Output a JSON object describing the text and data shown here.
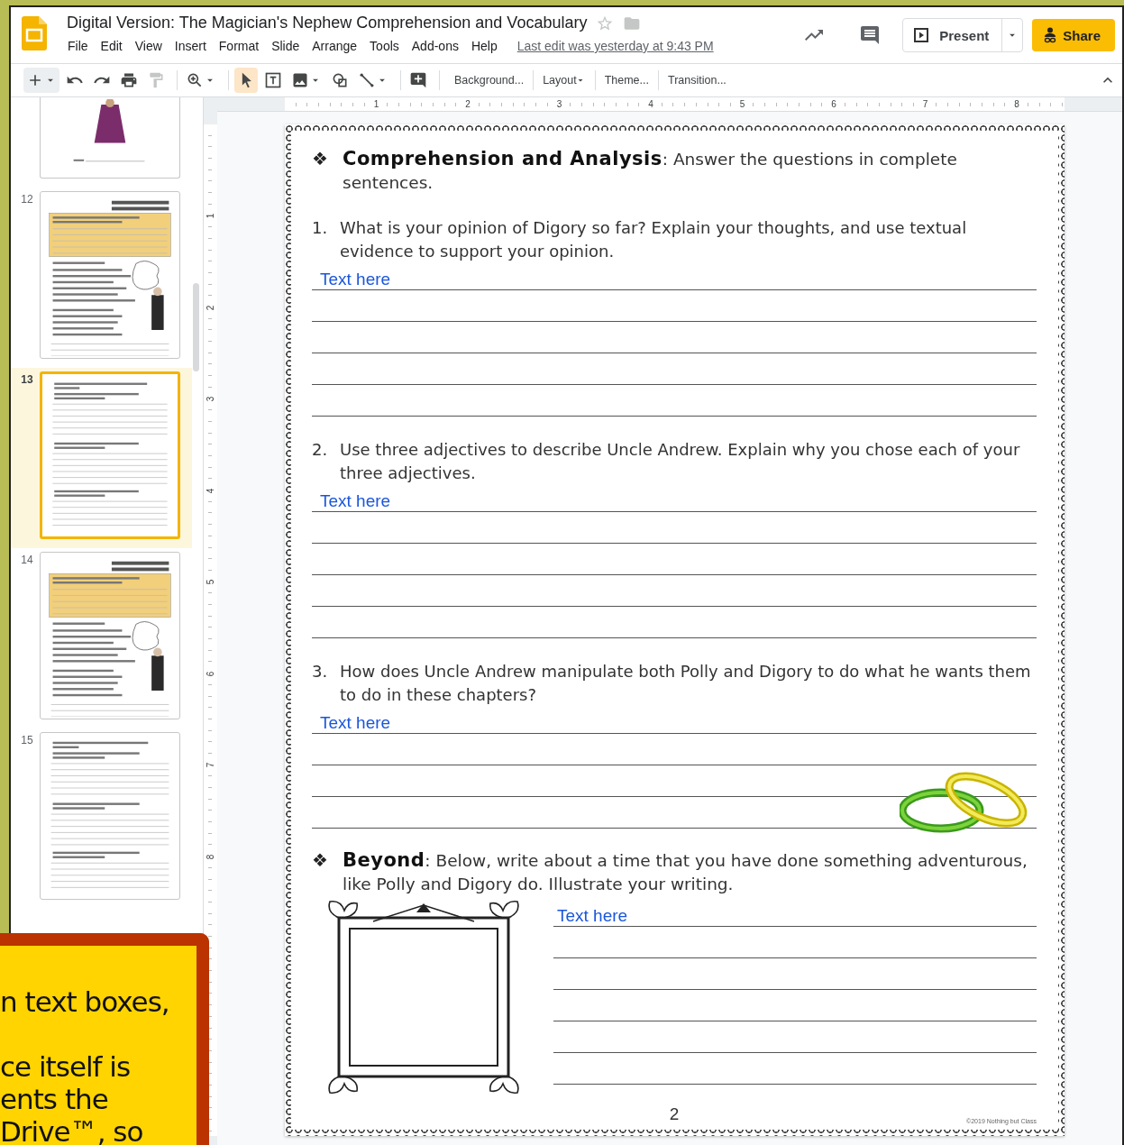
{
  "header": {
    "title": "Digital Version: The Magician's Nephew Comprehension and Vocabulary",
    "starred": false,
    "menu": [
      "File",
      "Edit",
      "View",
      "Insert",
      "Format",
      "Slide",
      "Arrange",
      "Tools",
      "Add-ons",
      "Help"
    ],
    "last_edit": "Last edit was yesterday at 9:43 PM",
    "present": "Present",
    "share": "Share"
  },
  "toolbar": {
    "tools": [
      {
        "kind": "new",
        "dropdown": true,
        "selected": false,
        "disabled": false
      },
      {
        "kind": "undo",
        "dropdown": false,
        "selected": false,
        "disabled": false
      },
      {
        "kind": "redo",
        "dropdown": false,
        "selected": false,
        "disabled": false
      },
      {
        "kind": "print",
        "dropdown": false,
        "selected": false,
        "disabled": false
      },
      {
        "kind": "paint",
        "dropdown": false,
        "selected": false,
        "disabled": true
      },
      {
        "kind": "zoom",
        "dropdown": true,
        "selected": false,
        "disabled": false
      },
      {
        "kind": "select",
        "dropdown": false,
        "selected": true,
        "disabled": false
      },
      {
        "kind": "textbox",
        "dropdown": false,
        "selected": false,
        "disabled": false
      },
      {
        "kind": "image",
        "dropdown": true,
        "selected": false,
        "disabled": false
      },
      {
        "kind": "shape",
        "dropdown": false,
        "selected": false,
        "disabled": false
      },
      {
        "kind": "line",
        "dropdown": true,
        "selected": false,
        "disabled": false
      },
      {
        "kind": "comment",
        "dropdown": false,
        "selected": false,
        "disabled": false
      }
    ],
    "text_buttons": [
      {
        "label": "Background...",
        "dropdown": false
      },
      {
        "label": "Layout",
        "dropdown": true
      },
      {
        "label": "Theme...",
        "dropdown": false
      },
      {
        "label": "Transition...",
        "dropdown": false
      }
    ]
  },
  "rulers": {
    "horizontal": [
      "1",
      "2",
      "3",
      "4",
      "5",
      "6",
      "7",
      "8"
    ],
    "vertical": [
      "1",
      "2",
      "3",
      "4",
      "5",
      "6",
      "7",
      "8"
    ]
  },
  "filmstrip": {
    "slides": [
      {
        "kind": "cover",
        "selected": false
      },
      {
        "number": "12",
        "kind": "chapter",
        "selected": false
      },
      {
        "number": "13",
        "kind": "questions",
        "selected": true
      },
      {
        "number": "14",
        "kind": "chapter",
        "selected": false
      },
      {
        "number": "15",
        "kind": "questions",
        "selected": false
      }
    ]
  },
  "slide": {
    "sections": [
      {
        "kind": "questions",
        "bullet": "❖",
        "heading": "**Comprehension and Analysis**: Answer the questions in complete sentences.",
        "questions": [
          {
            "number": "1.",
            "text": "What is your opinion of Digory so far? Explain your thoughts, and use textual evidence to support your opinion.",
            "answer": "Text here"
          },
          {
            "number": "2.",
            "text": "Use three adjectives to describe Uncle Andrew. Explain why you chose each of your three adjectives.",
            "answer": "Text here"
          },
          {
            "number": "3.",
            "text": "How does Uncle Andrew manipulate both Polly and Digory to do what he wants them to do in these chapters?",
            "answer": "Text here"
          }
        ]
      },
      {
        "kind": "drawing",
        "bullet": "❖",
        "heading": "**Beyond**: Below, write about a time that you have done something adventurous, like Polly and Digory do. Illustrate your writing.",
        "answer": "Text here"
      }
    ],
    "page_number": "2",
    "copyright": "©2019 Nothing but Class"
  },
  "promo": {
    "paragraphs": [
      [
        "n text boxes,"
      ],
      [
        "ce itself is",
        "ents the",
        "Drive™, so"
      ]
    ]
  }
}
